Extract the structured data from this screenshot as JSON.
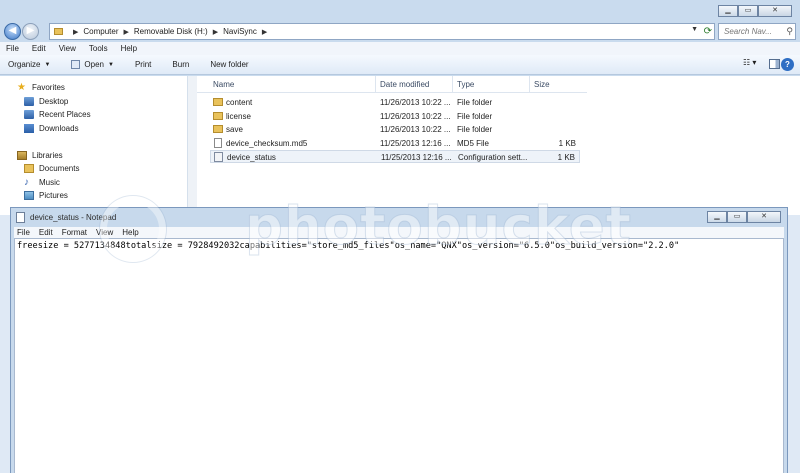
{
  "explorer": {
    "address_crumbs": [
      "Computer",
      "Removable Disk (H:)",
      "NaviSync"
    ],
    "search_placeholder": "Search Nav...",
    "menu": [
      "File",
      "Edit",
      "View",
      "Tools",
      "Help"
    ],
    "toolbar": {
      "organize": "Organize",
      "open": "Open",
      "print": "Print",
      "burn": "Burn",
      "new_folder": "New folder"
    },
    "nav": {
      "favorites": "Favorites",
      "desktop": "Desktop",
      "recent_places": "Recent Places",
      "downloads": "Downloads",
      "libraries": "Libraries",
      "documents": "Documents",
      "music": "Music",
      "pictures": "Pictures"
    },
    "columns": {
      "name": "Name",
      "date_modified": "Date modified",
      "type": "Type",
      "size": "Size"
    },
    "files": [
      {
        "name": "content",
        "date": "11/26/2013 10:22 ...",
        "type": "File folder",
        "size": ""
      },
      {
        "name": "license",
        "date": "11/26/2013 10:22 ...",
        "type": "File folder",
        "size": ""
      },
      {
        "name": "save",
        "date": "11/26/2013 10:22 ...",
        "type": "File folder",
        "size": ""
      },
      {
        "name": "device_checksum.md5",
        "date": "11/25/2013 12:16 ...",
        "type": "MD5 File",
        "size": "1 KB"
      },
      {
        "name": "device_status",
        "date": "11/25/2013 12:16 ...",
        "type": "Configuration sett...",
        "size": "1 KB"
      }
    ]
  },
  "notepad": {
    "title": "device_status - Notepad",
    "menu": [
      "File",
      "Edit",
      "Format",
      "View",
      "Help"
    ],
    "content": "freesize = 5277134848totalsize = 7928492032capabilities=\"store_md5_files\"os_name=\"QNX\"os_version=\"6.5.0\"os_build_version=\"2.2.0\""
  },
  "watermark": {
    "text": "photobucket"
  }
}
